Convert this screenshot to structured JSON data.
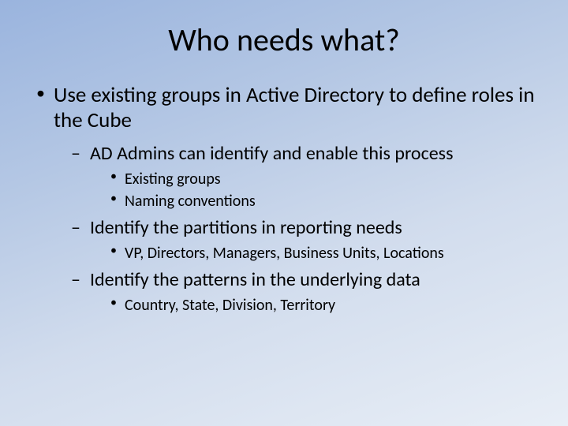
{
  "title": "Who needs what?",
  "bullets": {
    "l1_0": "Use existing groups in Active Directory to define roles in the Cube",
    "l2_0": "AD Admins can identify and enable this process",
    "l3_0": "Existing groups",
    "l3_1": "Naming conventions",
    "l2_1": "Identify the partitions in reporting needs",
    "l3_2": "VP, Directors, Managers, Business Units, Locations",
    "l2_2": "Identify the patterns in the underlying data",
    "l3_3": "Country, State, Division, Territory"
  }
}
